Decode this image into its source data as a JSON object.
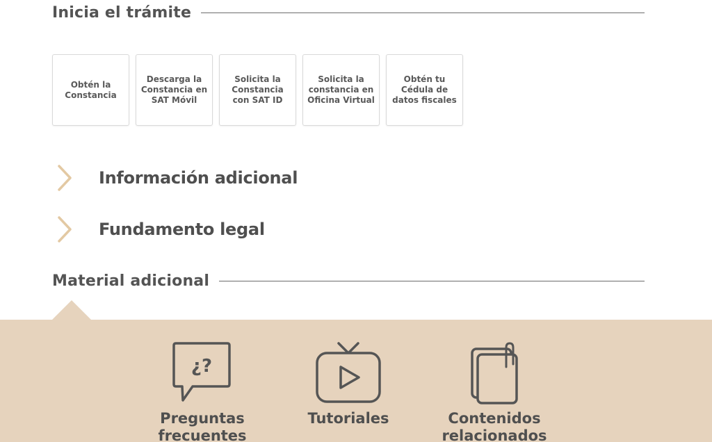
{
  "inicia": {
    "title": "Inicia el trámite"
  },
  "cards": [
    {
      "label": "Obtén la Constancia"
    },
    {
      "label": "Descarga la Constancia en SAT Móvil"
    },
    {
      "label": "Solicita la Constancia con SAT ID"
    },
    {
      "label": "Solicita la constancia en Oficina Virtual"
    },
    {
      "label": "Obtén tu Cédula de datos fiscales"
    }
  ],
  "accordions": [
    {
      "label": "Información adicional",
      "icon": "chevron-right-icon"
    },
    {
      "label": "Fundamento legal",
      "icon": "chevron-right-icon"
    }
  ],
  "material": {
    "title": "Material adicional"
  },
  "resources": [
    {
      "label": "Preguntas frecuentes",
      "icon": "faq-speech-bubble-icon",
      "glyph": "¿?"
    },
    {
      "label": "Tutoriales",
      "icon": "tv-play-icon"
    },
    {
      "label": "Contenidos relacionados",
      "icon": "documents-clip-icon"
    }
  ],
  "colors": {
    "accent": "#e6d3bd",
    "chevron": "#e3c9a3",
    "text": "#545454",
    "icon_stroke": "#555555"
  }
}
